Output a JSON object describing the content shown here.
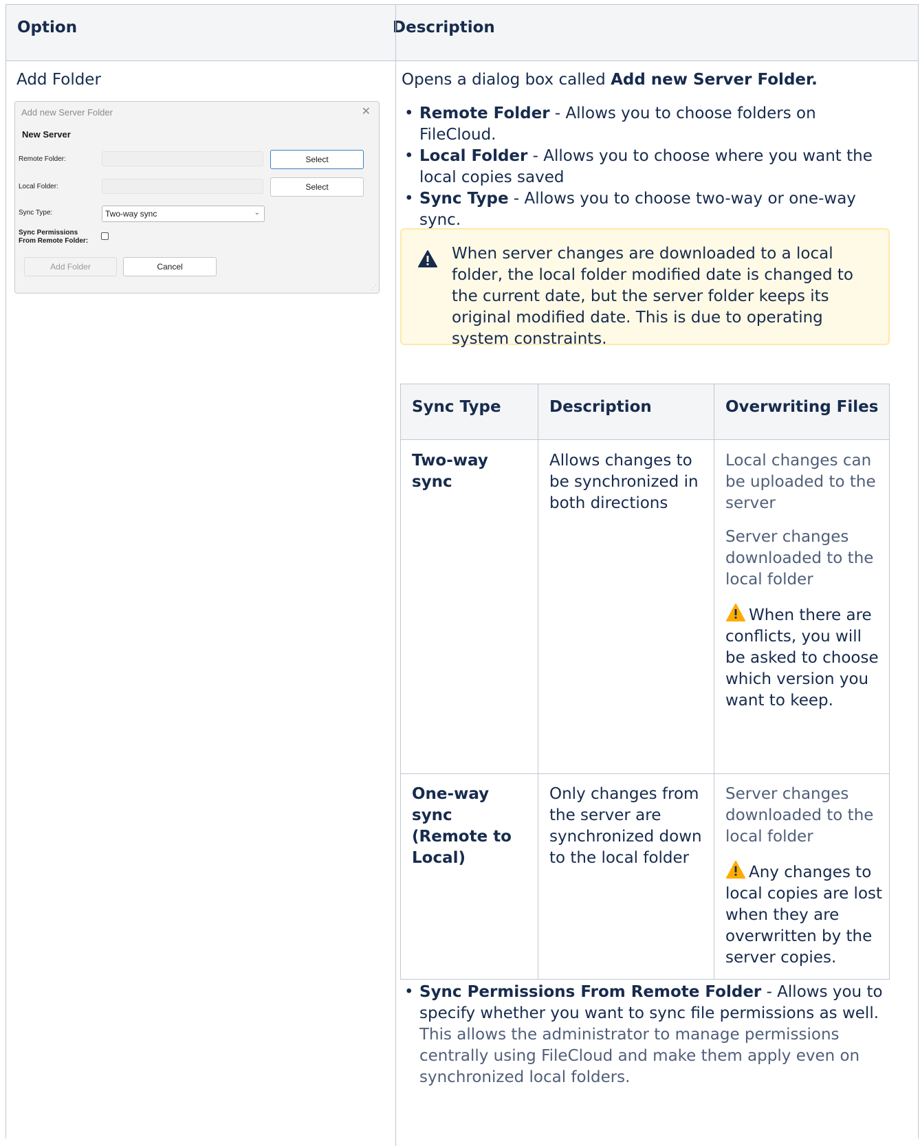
{
  "table": {
    "headers": {
      "option": "Option",
      "description": "Description"
    },
    "option_name": "Add Folder"
  },
  "dialog": {
    "title": "Add new Server Folder",
    "section": "New Server",
    "remote_label": "Remote Folder:",
    "local_label": "Local Folder:",
    "sync_type_label": "Sync Type:",
    "sync_perm_label_1": "Sync Permissions",
    "sync_perm_label_2": "From Remote Folder:",
    "sync_type_value": "Two-way sync",
    "select_label": "Select",
    "add_label": "Add Folder",
    "cancel_label": "Cancel"
  },
  "description": {
    "intro_prefix": "Opens a dialog box called ",
    "intro_bold": "Add new Server Folder.",
    "bullets": [
      {
        "term": "Remote Folder",
        "text": " - Allows you to choose folders on FileCloud."
      },
      {
        "term": "Local Folder",
        "text": " - Allows you to choose where you want the local copies saved"
      },
      {
        "term": "Sync Type",
        "text": " - Allows you to choose two-way or one-way sync."
      }
    ],
    "warning": "When server changes are downloaded to a local folder, the local folder modified date is changed to the current date, but the server folder keeps its original modified date. This is due to operating system constraints."
  },
  "sync_table": {
    "headers": [
      "Sync Type",
      "Description",
      "Overwriting Files"
    ],
    "rows": [
      {
        "type": "Two-way sync",
        "description": "Allows changes to be synchronized in both directions",
        "overwrite_1": "Local changes can be uploaded to the server",
        "overwrite_2": "Server changes downloaded to the local folder",
        "overwrite_warning": "When there are conflicts, you will be asked to choose which version you want to keep."
      },
      {
        "type": "One-way sync (Remote to Local)",
        "description": "Only changes from the server are synchronized down to the local folder",
        "overwrite_1": "Server changes downloaded to the local folder",
        "overwrite_warning": "Any changes to local copies are lost when they are overwritten by the server copies."
      }
    ]
  },
  "sync_permissions": {
    "term": "Sync Permissions From Remote Folder",
    "text": " - Allows you to specify whether you want to sync file permissions as well.",
    "note": "This allows the administrator to manage permissions centrally using FileCloud and make them apply even on synchronized local folders."
  },
  "colors": {
    "border": "#c1c7d0",
    "header_bg": "#f4f5f7",
    "warning_bg": "#fffae6",
    "warning_icon": "#ffab00"
  }
}
